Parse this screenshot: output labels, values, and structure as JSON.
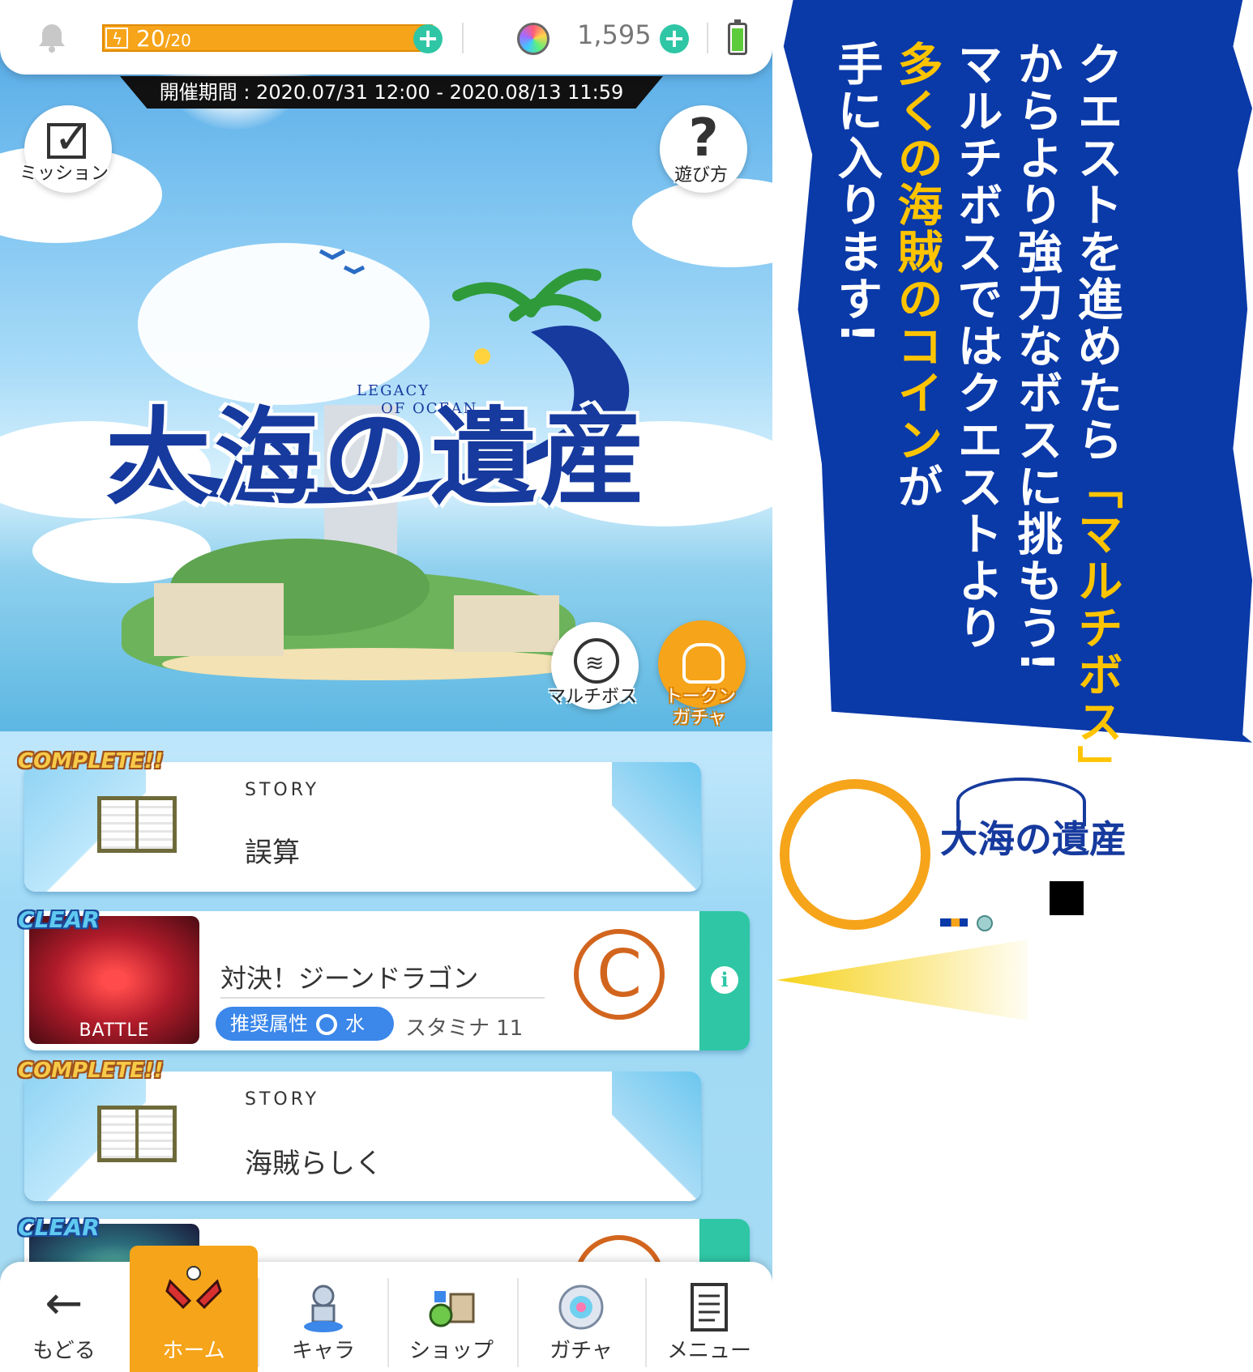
{
  "status_bar": {
    "stamina_current": "20",
    "stamina_max": "/20",
    "gem_count": "1,595",
    "icons": [
      "bell-icon",
      "lightning-icon",
      "plus-icon",
      "gem-icon",
      "battery-icon"
    ]
  },
  "event": {
    "period": "開催期間 : 2020.07/31 12:00 - 2020.08/13 11:59",
    "logo_main": "大海の遺産",
    "logo_sub_1": "LEGACY",
    "logo_sub_2": "OF OCEAN"
  },
  "buttons": {
    "mission": "ミッション",
    "howto": "遊び方",
    "multiboss": "マルチボス",
    "token_gacha_1": "トークン",
    "token_gacha_2": "ガチャ"
  },
  "quests": [
    {
      "badge": "COMPLETE!!",
      "type": "STORY",
      "title": "誤算"
    },
    {
      "badge": "CLEAR",
      "thumb_label": "BATTLE",
      "title": "対決！ジーンドラゴン",
      "attr_label": "推奨属性",
      "attr_value": "水",
      "stamina": "スタミナ 11",
      "rank": "C"
    },
    {
      "badge": "COMPLETE!!",
      "type": "STORY",
      "title": "海賊らしく"
    },
    {
      "badge": "CLEAR"
    }
  ],
  "nav": {
    "items": [
      {
        "label": "もどる",
        "icon": "back-arrow-icon"
      },
      {
        "label": "ホーム",
        "icon": "home-icon",
        "active": true
      },
      {
        "label": "キャラ",
        "icon": "character-icon"
      },
      {
        "label": "ショップ",
        "icon": "shop-icon"
      },
      {
        "label": "ガチャ",
        "icon": "gacha-icon"
      },
      {
        "label": "メニュー",
        "icon": "menu-icon"
      }
    ]
  },
  "banner": {
    "line1": "クエストを進めたら",
    "line1_hl": "「マルチボス」",
    "line2": "からより強力なボスに挑もう!",
    "line3": "マルチボスではクエストより",
    "line4_hl": "多くの海賊のコイン",
    "line4": "が",
    "line5": "手に入ります!"
  },
  "mini_logo": "大海の遺産",
  "colors": {
    "accent_orange": "#f6a41a",
    "accent_teal": "#2fc6a5",
    "banner_blue": "#0a39a8",
    "logo_navy": "#163a9e",
    "highlight_yellow": "#ffc400"
  }
}
